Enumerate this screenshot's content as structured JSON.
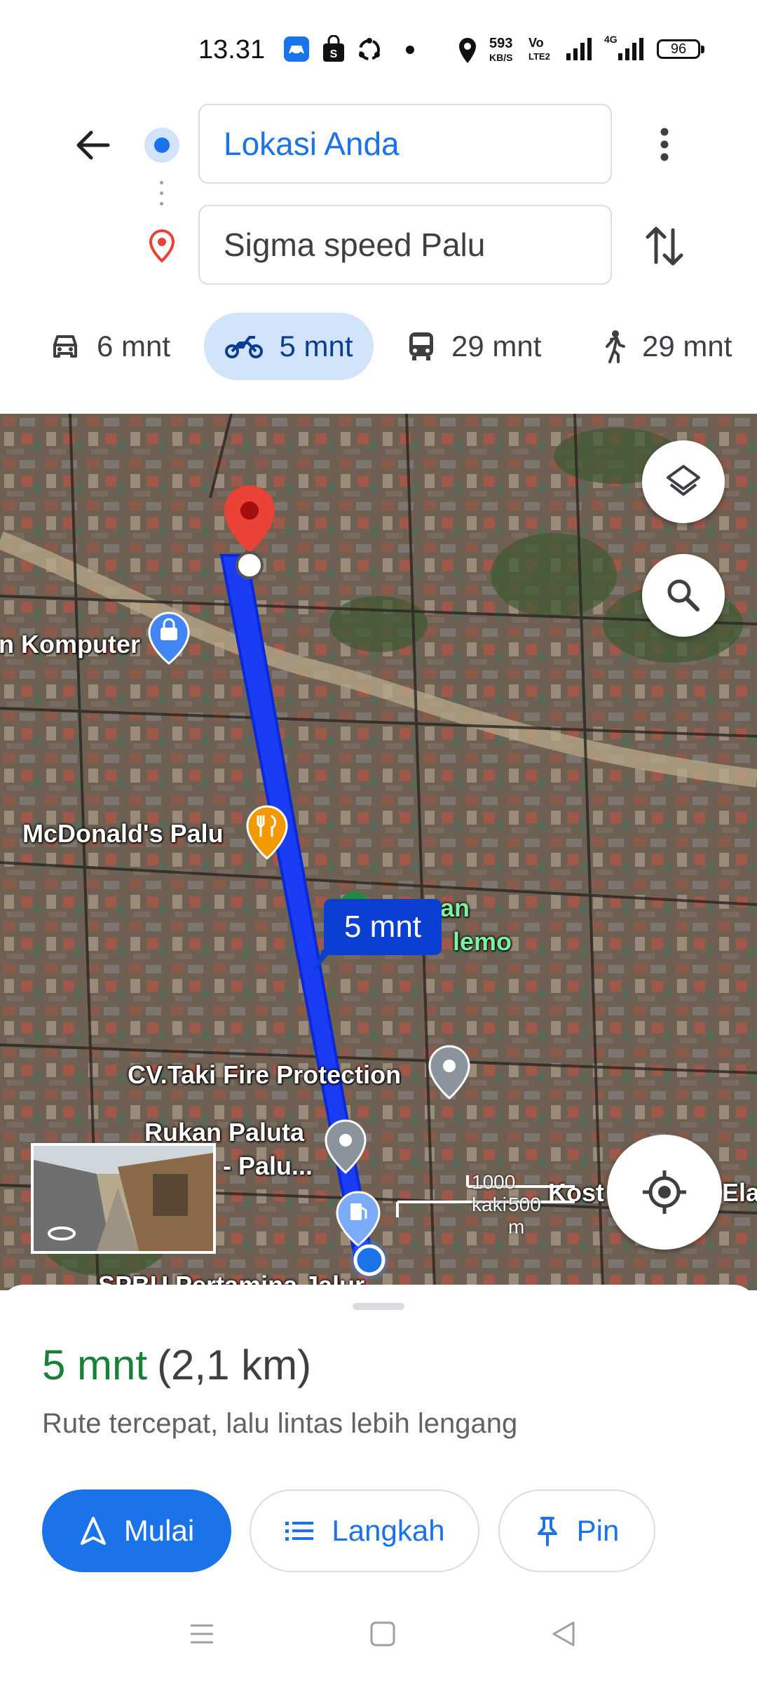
{
  "status_bar": {
    "time": "13.31",
    "net_speed_value": "593",
    "net_speed_unit": "KB/S",
    "volte_top": "Vo",
    "volte_bottom": "LTE2",
    "network_type": "4G",
    "battery": "96",
    "icons": [
      "android-auto-icon",
      "shopping-bag-icon",
      "sync-icon",
      "dot-icon",
      "location-icon",
      "signal-icon",
      "signal-4g-icon",
      "battery-icon"
    ]
  },
  "directions": {
    "origin_value": "Lokasi Anda",
    "destination_value": "Sigma speed Palu"
  },
  "travel_modes": [
    {
      "icon": "car-icon",
      "label": "6 mnt",
      "selected": false
    },
    {
      "icon": "motorcycle-icon",
      "label": "5 mnt",
      "selected": true
    },
    {
      "icon": "transit-icon",
      "label": "29 mnt",
      "selected": false
    },
    {
      "icon": "walk-icon",
      "label": "29 mnt",
      "selected": false
    }
  ],
  "map": {
    "labels": {
      "komputer": "n Komputer",
      "mcdonalds": "McDonald's Palu",
      "taman_1": "man",
      "taman_2": "lemo",
      "taki": "CV.Taki Fire Protection",
      "rukan_1": "Rukan Paluta",
      "rukan_2": "- Palu...",
      "kost": "Kost E",
      "ela": "Ela",
      "spbu": "SPBU Pertamina Jalur"
    },
    "route_badge": "5 mnt",
    "scale_feet": "1000 kaki",
    "scale_meters": "500 m",
    "route_color": "#1a3cf5"
  },
  "sheet": {
    "eta_time": "5 mnt",
    "eta_distance": "(2,1 km)",
    "description": "Rute tercepat, lalu lintas lebih lengang",
    "start_label": "Mulai",
    "steps_label": "Langkah",
    "pin_label": "Pin"
  },
  "colors": {
    "accent": "#1a73e8",
    "eta_green": "#188038",
    "selected_mode_bg": "#d2e3fc",
    "destination_red": "#ea4335"
  }
}
